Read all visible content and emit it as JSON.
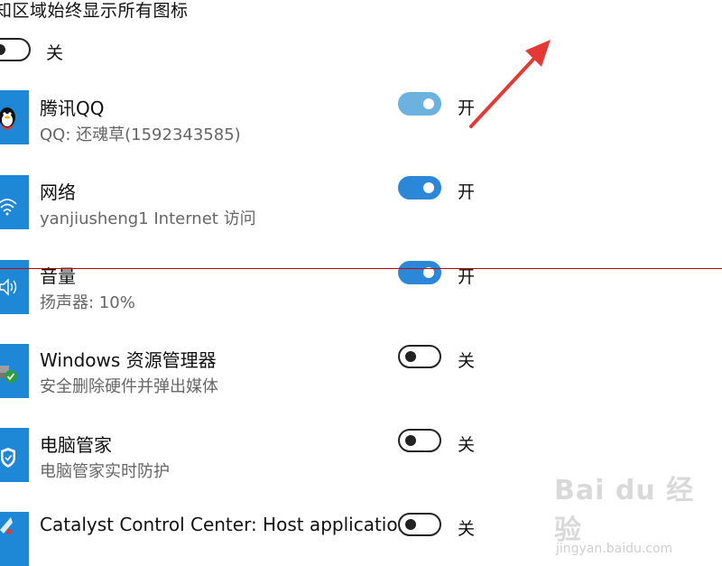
{
  "header": {
    "title": "知区域始终显示所有图标",
    "always_show_state": "关"
  },
  "apps": [
    {
      "name": "腾讯QQ",
      "desc": "QQ:  还魂草(1592343585)",
      "state": "开",
      "icon": "qq-penguin-icon"
    },
    {
      "name": "网络",
      "desc": "yanjiusheng1 Internet 访问",
      "state": "开",
      "icon": "wifi-icon"
    },
    {
      "name": "音量",
      "desc": "扬声器: 10%",
      "state": "开",
      "icon": "speaker-icon"
    },
    {
      "name": "Windows 资源管理器",
      "desc": "安全删除硬件并弹出媒体",
      "state": "关",
      "icon": "safely-remove-hardware-icon"
    },
    {
      "name": "电脑管家",
      "desc": "电脑管家实时防护",
      "state": "关",
      "icon": "shield-icon"
    },
    {
      "name": "Catalyst Control Center: Host application",
      "desc": "",
      "state": "关",
      "icon": "catalyst-icon"
    }
  ],
  "watermark": {
    "main": "Bai du 经验",
    "sub": "jingyan.baidu.com"
  },
  "colors": {
    "accent": "#2b88d8",
    "accent_light": "#6bb2e0",
    "annotation_red": "#e53935",
    "icon_tile": "#1e88d6"
  }
}
